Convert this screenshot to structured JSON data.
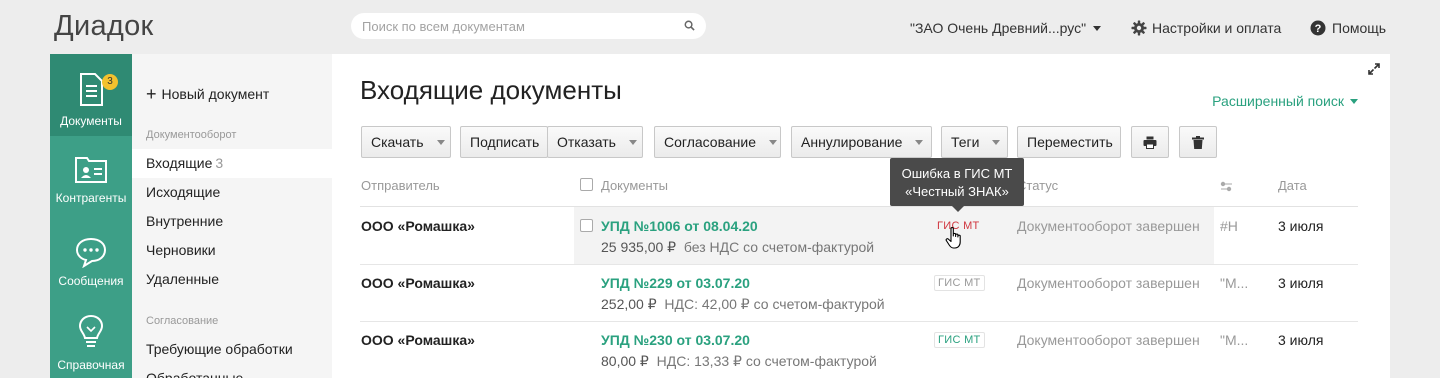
{
  "app": {
    "logo": "Диадок",
    "search_placeholder": "Поиск по всем документам",
    "org_name": "\"ЗАО Очень Древний...рус\"",
    "settings_label": "Настройки и оплата",
    "help_label": "Помощь"
  },
  "rail": {
    "items": [
      {
        "label": "Документы",
        "icon": "document-icon",
        "badge": "3"
      },
      {
        "label": "Контрагенты",
        "icon": "contact-card-icon"
      },
      {
        "label": "Сообщения",
        "icon": "chat-bubble-icon"
      },
      {
        "label": "Справочная",
        "icon": "lightbulb-icon"
      }
    ]
  },
  "sidebar": {
    "new_doc": "Новый документ",
    "section_docflow": "Документооборот",
    "items": [
      {
        "label": "Входящие",
        "count": "3"
      },
      {
        "label": "Исходящие"
      },
      {
        "label": "Внутренние"
      },
      {
        "label": "Черновики"
      },
      {
        "label": "Удаленные"
      }
    ],
    "section_approval": "Согласование",
    "approval_items": [
      {
        "label": "Требующие обработки"
      },
      {
        "label": "Обработанные"
      }
    ]
  },
  "main": {
    "title": "Входящие документы",
    "advanced_search": "Расширенный поиск",
    "toolbar": {
      "download": "Скачать",
      "sign": "Подписать",
      "reject": "Отказать",
      "approval": "Согласование",
      "annul": "Аннулирование",
      "tags": "Теги",
      "move": "Переместить",
      "print_icon": "printer-icon",
      "delete_icon": "trash-icon"
    },
    "columns": {
      "sender": "Отправитель",
      "documents": "Документы",
      "status": "Статус",
      "tags_icon": "tag-icon",
      "date": "Дата"
    },
    "rows": [
      {
        "sender": "ООО «Ромашка»",
        "doc_title": "УПД №1006 от 08.04.20",
        "amount": "25 935,00 ₽",
        "vat_note": "без НДС со счетом-фактурой",
        "gis": "ГИС МТ",
        "status": "Документооборот завершен",
        "tag": "#Н",
        "date": "3 июля"
      },
      {
        "sender": "ООО «Ромашка»",
        "doc_title": "УПД №229 от 03.07.20",
        "amount": "252,00 ₽",
        "vat_note": "НДС: 42,00 ₽ со счетом-фактурой",
        "gis": "ГИС МТ",
        "status": "Документооборот завершен",
        "tag": "\"М...",
        "date": "3 июля"
      },
      {
        "sender": "ООО «Ромашка»",
        "doc_title": "УПД №230 от 03.07.20",
        "amount": "80,00 ₽",
        "vat_note": "НДС: 13,33 ₽ со счетом-фактурой",
        "gis": "ГИС МТ",
        "status": "Документооборот завершен",
        "tag": "\"М...",
        "date": "3 июля"
      }
    ],
    "gis_colors": {
      "error": "#d0363f",
      "neutral": "#999999",
      "ok": "#2aa17f"
    },
    "tooltip": {
      "line1": "Ошибка в ГИС МТ",
      "line2": "«Честный ЗНАК»"
    }
  },
  "colors": {
    "brand_green": "#3d9f87",
    "link_green": "#2aa17f"
  }
}
